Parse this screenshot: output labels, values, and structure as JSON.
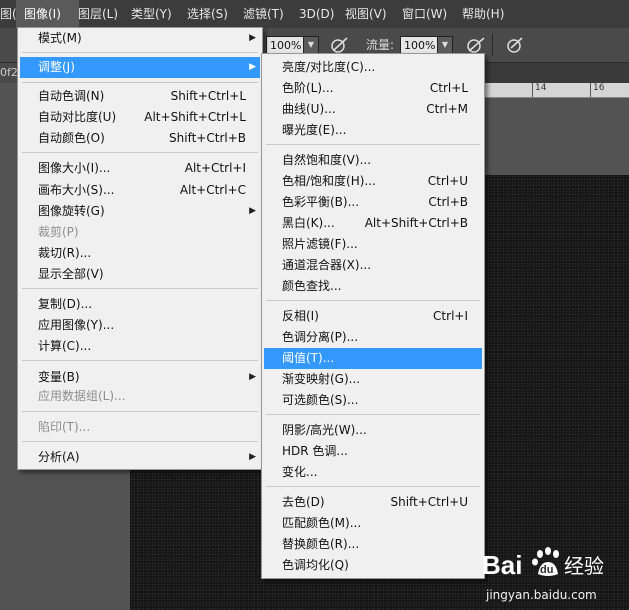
{
  "menubar": {
    "items": [
      "图(E)",
      "图像(I)",
      "图层(L)",
      "类型(Y)",
      "选择(S)",
      "滤镜(T)",
      "3D(D)",
      "视图(V)",
      "窗口(W)",
      "帮助(H)"
    ]
  },
  "optionsbar": {
    "opacity_value": "100%",
    "flow_label": "流量:",
    "flow_value": "100%"
  },
  "doc_tab": {
    "label": "0f2"
  },
  "ruler": {
    "ticks": [
      "14",
      "16"
    ]
  },
  "image_menu": {
    "items": [
      {
        "label": "模式(M)",
        "submenu": true
      },
      {
        "label": "调整(J)",
        "submenu": true,
        "highlighted": true
      },
      {
        "label": "自动色调(N)",
        "shortcut": "Shift+Ctrl+L"
      },
      {
        "label": "自动对比度(U)",
        "shortcut": "Alt+Shift+Ctrl+L"
      },
      {
        "label": "自动颜色(O)",
        "shortcut": "Shift+Ctrl+B"
      },
      {
        "label": "图像大小(I)...",
        "shortcut": "Alt+Ctrl+I"
      },
      {
        "label": "画布大小(S)...",
        "shortcut": "Alt+Ctrl+C"
      },
      {
        "label": "图像旋转(G)",
        "submenu": true
      },
      {
        "label": "裁剪(P)",
        "disabled": true
      },
      {
        "label": "裁切(R)..."
      },
      {
        "label": "显示全部(V)"
      },
      {
        "label": "复制(D)..."
      },
      {
        "label": "应用图像(Y)..."
      },
      {
        "label": "计算(C)..."
      },
      {
        "label": "变量(B)",
        "submenu": true
      },
      {
        "label": "应用数据组(L)...",
        "disabled": true
      },
      {
        "label": "陷印(T)...",
        "disabled": true
      },
      {
        "label": "分析(A)",
        "submenu": true
      }
    ]
  },
  "adjust_menu": {
    "items": [
      {
        "label": "亮度/对比度(C)..."
      },
      {
        "label": "色阶(L)...",
        "shortcut": "Ctrl+L"
      },
      {
        "label": "曲线(U)...",
        "shortcut": "Ctrl+M"
      },
      {
        "label": "曝光度(E)..."
      },
      {
        "label": "自然饱和度(V)..."
      },
      {
        "label": "色相/饱和度(H)...",
        "shortcut": "Ctrl+U"
      },
      {
        "label": "色彩平衡(B)...",
        "shortcut": "Ctrl+B"
      },
      {
        "label": "黑白(K)...",
        "shortcut": "Alt+Shift+Ctrl+B"
      },
      {
        "label": "照片滤镜(F)..."
      },
      {
        "label": "通道混合器(X)..."
      },
      {
        "label": "颜色查找..."
      },
      {
        "label": "反相(I)",
        "shortcut": "Ctrl+I"
      },
      {
        "label": "色调分离(P)..."
      },
      {
        "label": "阈值(T)...",
        "highlighted": true
      },
      {
        "label": "渐变映射(G)..."
      },
      {
        "label": "可选颜色(S)..."
      },
      {
        "label": "阴影/高光(W)..."
      },
      {
        "label": "HDR 色调..."
      },
      {
        "label": "变化..."
      },
      {
        "label": "去色(D)",
        "shortcut": "Shift+Ctrl+U"
      },
      {
        "label": "匹配颜色(M)..."
      },
      {
        "label": "替换颜色(R)..."
      },
      {
        "label": "色调均化(Q)"
      }
    ]
  },
  "watermark": {
    "brand": "Bai",
    "brand_du": "du",
    "brand_cn": "经验",
    "domain": "jingyan.baidu.com"
  },
  "colors": {
    "highlight": "#3399ff",
    "menu_bg": "#f0f0f0",
    "menubar_bg": "#3c3c3c"
  }
}
